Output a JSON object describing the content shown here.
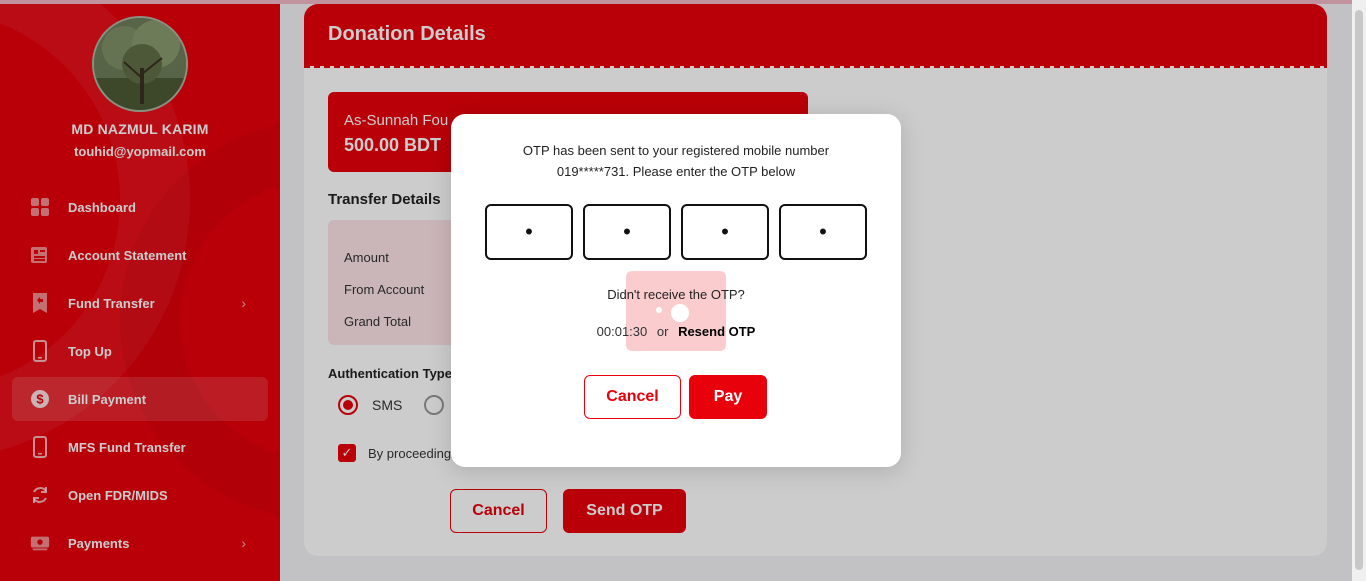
{
  "user": {
    "name": "MD NAZMUL KARIM",
    "email": "touhid@yopmail.com"
  },
  "sidebar": {
    "items": [
      {
        "label": "Dashboard",
        "icon": "grid-icon",
        "has_chevron": false,
        "active": false
      },
      {
        "label": "Account Statement",
        "icon": "statement-icon",
        "has_chevron": false,
        "active": false
      },
      {
        "label": "Fund Transfer",
        "icon": "fund-transfer-icon",
        "has_chevron": true,
        "active": false
      },
      {
        "label": "Top Up",
        "icon": "mobile-icon",
        "has_chevron": false,
        "active": false
      },
      {
        "label": "Bill Payment",
        "icon": "dollar-icon",
        "has_chevron": false,
        "active": true
      },
      {
        "label": "MFS Fund Transfer",
        "icon": "mobile-icon",
        "has_chevron": false,
        "active": false
      },
      {
        "label": "Open FDR/MIDS",
        "icon": "refresh-icon",
        "has_chevron": false,
        "active": false
      },
      {
        "label": "Payments",
        "icon": "payments-icon",
        "has_chevron": true,
        "active": false
      }
    ]
  },
  "page": {
    "title": "Donation Details",
    "org_name": "As-Sunnah Fou",
    "amount": "500.00 BDT",
    "transfer_title": "Transfer Details",
    "transfer_rows": [
      "Amount",
      "From Account",
      "Grand Total"
    ],
    "auth_title": "Authentication Type",
    "auth_options": [
      "SMS"
    ],
    "consent_label": "By proceeding",
    "cancel_label": "Cancel",
    "send_otp_label": "Send OTP"
  },
  "modal": {
    "message_line1": "OTP has been sent to your registered mobile number",
    "message_line2": "019*****731. Please enter the OTP below",
    "otp_digits": [
      "•",
      "•",
      "•",
      "•"
    ],
    "didnt_receive": "Didn't receive the OTP?",
    "timer": "00:01:30",
    "or_text": "or",
    "resend_label": "Resend OTP",
    "cancel_label": "Cancel",
    "pay_label": "Pay"
  },
  "colors": {
    "brand_red": "#e8000b",
    "light_pink": "#fde4e6"
  }
}
